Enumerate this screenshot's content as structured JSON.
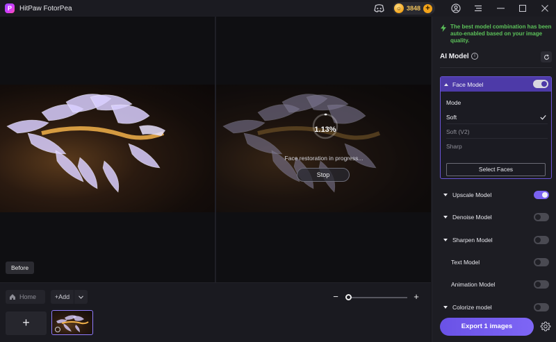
{
  "app": {
    "title": "HitPaw FotorPea",
    "logo_letter": "P"
  },
  "titlebar": {
    "coins": "3848",
    "coin_plus": "+",
    "icons": [
      "discord-icon",
      "coin-icon",
      "account-icon",
      "menu-icon",
      "minimize-icon",
      "maximize-icon",
      "close-icon"
    ]
  },
  "canvas": {
    "before_label": "Before",
    "progress": {
      "percent_text": "1.13%",
      "fraction": 0.0113
    },
    "caption": "Face restoration in progress...",
    "stop_label": "Stop"
  },
  "bottom": {
    "home_label": "Home",
    "add_label": "+Add",
    "add_tile": "+",
    "zoom_minus": "−",
    "zoom_plus": "+",
    "zoom_level": 0.0
  },
  "panel": {
    "notice": "The best model combination has been auto-enabled based on your image quality.",
    "section_title": "AI Model",
    "info_glyph": "i",
    "face_model": {
      "label": "Face Model",
      "enabled": true,
      "mode_label": "Mode",
      "options": [
        {
          "label": "Soft",
          "selected": true
        },
        {
          "label": "Soft (V2)",
          "selected": false
        },
        {
          "label": "Sharp",
          "selected": false
        }
      ],
      "select_faces_label": "Select Faces"
    },
    "models": [
      {
        "label": "Upscale Model",
        "enabled": true,
        "has_caret": true
      },
      {
        "label": "Denoise Model",
        "enabled": false,
        "has_caret": true
      },
      {
        "label": "Sharpen Model",
        "enabled": false,
        "has_caret": true
      },
      {
        "label": "Text Model",
        "enabled": false,
        "has_caret": false
      },
      {
        "label": "Animation Model",
        "enabled": false,
        "has_caret": false
      },
      {
        "label": "Colorize model",
        "enabled": false,
        "has_caret": true
      }
    ],
    "export_label": "Export 1 images"
  },
  "colors": {
    "accent": "#7a62f0",
    "notice_green": "#5cc25a",
    "coin_gold": "#f2a31a"
  }
}
